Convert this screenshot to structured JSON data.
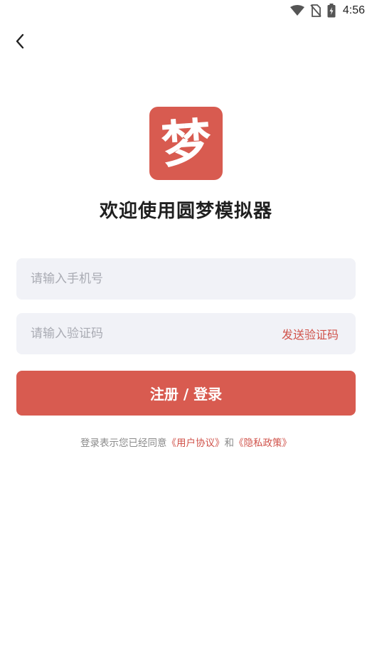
{
  "status_bar": {
    "time": "4:56",
    "icons": [
      "wifi-icon",
      "no-sim-icon",
      "battery-charging-icon"
    ]
  },
  "nav": {
    "back_icon": "chevron-left-icon"
  },
  "logo": {
    "char": "梦",
    "color": "#d85b50"
  },
  "welcome_title": "欢迎使用圆梦模拟器",
  "phone_field": {
    "placeholder": "请输入手机号",
    "value": ""
  },
  "code_field": {
    "placeholder": "请输入验证码",
    "value": "",
    "send_label": "发送验证码"
  },
  "login_button": {
    "label": "注册 / 登录"
  },
  "agreement": {
    "prefix": "登录表示您已经同意",
    "user_agreement": "《用户协议》",
    "conjunction": "和",
    "privacy_policy": "《隐私政策》"
  },
  "colors": {
    "accent": "#d85b50",
    "input_bg": "#f1f2f7",
    "link": "#d0524a"
  }
}
